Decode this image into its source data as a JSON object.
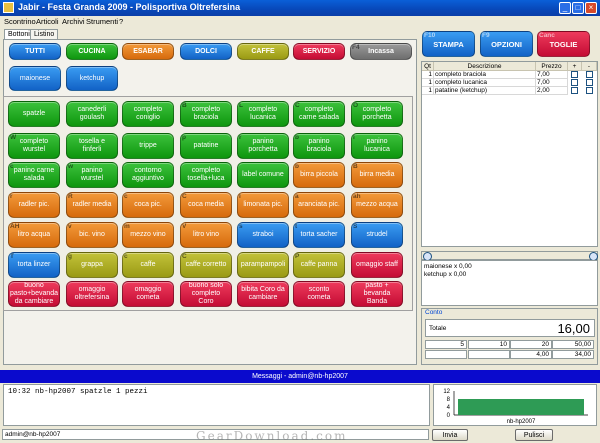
{
  "window": {
    "title": "Jabir - Festa Granda 2009 - Polisportiva Oltrefersina"
  },
  "menu": [
    "Scontrino",
    "Articoli",
    "Archivi",
    "Strumenti",
    "?"
  ],
  "tabs": [
    "Bottoni",
    "Listino"
  ],
  "categories": [
    {
      "label": "TUTTI",
      "color": "blue"
    },
    {
      "label": "CUCINA",
      "color": "green"
    },
    {
      "label": "ESABAR",
      "color": "orange"
    },
    {
      "label": "DOLCI",
      "color": "blue"
    },
    {
      "label": "CAFFE",
      "color": "olive"
    },
    {
      "label": "SERVIZIO",
      "color": "red"
    },
    {
      "label": "Incassa",
      "color": "grey",
      "key": "F4"
    }
  ],
  "notes_buttons": [
    "maionese",
    "ketchup"
  ],
  "product_rows": [
    [
      {
        "l": "spatzle",
        "c": "green"
      },
      {
        "l": "canederli goulash",
        "c": "green"
      },
      {
        "l": "completo coniglio",
        "c": "green"
      },
      {
        "l": "completo braciola",
        "c": "green",
        "k": "B"
      },
      {
        "l": "completo lucanica",
        "c": "green",
        "k": "L"
      },
      {
        "l": "completo carne salada",
        "c": "green",
        "k": "C"
      },
      {
        "l": "completo porchetta",
        "c": "green",
        "k": "O"
      }
    ],
    [
      {
        "l": "completo wurstel",
        "c": "green",
        "k": "W"
      },
      {
        "l": "tosella e finferli",
        "c": "green"
      },
      {
        "l": "trippe",
        "c": "green"
      },
      {
        "l": "patatine",
        "c": "green",
        "k": "p"
      },
      {
        "l": "panino porchetta",
        "c": "green",
        "k": "r"
      },
      {
        "l": "panino braciola",
        "c": "green",
        "k": "b"
      },
      {
        "l": "panino lucanica",
        "c": "green",
        "k": "l"
      }
    ],
    [
      {
        "l": "panino carne salada",
        "c": "green",
        "k": "c"
      },
      {
        "l": "panino wurstel",
        "c": "green",
        "k": "w"
      },
      {
        "l": "contorno aggiuntivo",
        "c": "green"
      },
      {
        "l": "completo tosella+luca",
        "c": "green"
      },
      {
        "l": "label comune",
        "c": "green"
      },
      {
        "l": "birra piccola",
        "c": "orange",
        "k": "b"
      },
      {
        "l": "birra media",
        "c": "orange",
        "k": "B"
      }
    ],
    [
      {
        "l": "radler pic.",
        "c": "orange",
        "k": "r"
      },
      {
        "l": "radler media",
        "c": "orange",
        "k": "R"
      },
      {
        "l": "coca pic.",
        "c": "orange",
        "k": "c"
      },
      {
        "l": "coca media",
        "c": "orange",
        "k": "C"
      },
      {
        "l": "limonata pic.",
        "c": "orange",
        "k": "l"
      },
      {
        "l": "aranciata pic.",
        "c": "orange",
        "k": "a"
      },
      {
        "l": "mezzo acqua",
        "c": "orange",
        "k": "ah"
      }
    ],
    [
      {
        "l": "litro acqua",
        "c": "orange",
        "k": "AH"
      },
      {
        "l": "bic. vino",
        "c": "orange",
        "k": "v"
      },
      {
        "l": "mezzo vino",
        "c": "orange",
        "k": "m"
      },
      {
        "l": "litro vino",
        "c": "orange",
        "k": "V"
      },
      {
        "l": "straboi",
        "c": "blue",
        "k": "s"
      },
      {
        "l": "torta sacher",
        "c": "blue",
        "k": "t"
      },
      {
        "l": "strudel",
        "c": "blue",
        "k": "S"
      }
    ],
    [
      {
        "l": "torta linzer",
        "c": "blue",
        "k": "T"
      },
      {
        "l": "grappa",
        "c": "olive",
        "k": "g"
      },
      {
        "l": "caffe",
        "c": "olive",
        "k": "c"
      },
      {
        "l": "caffe corretto",
        "c": "olive",
        "k": "C"
      },
      {
        "l": "parampampoli",
        "c": "olive"
      },
      {
        "l": "caffe panna",
        "c": "olive",
        "k": "P"
      },
      {
        "l": "omaggio staff",
        "c": "red"
      }
    ],
    [
      {
        "l": "buono pasto+bevanda da cambiare",
        "c": "red"
      },
      {
        "l": "omaggio oltrefersina",
        "c": "red"
      },
      {
        "l": "omaggio cometa",
        "c": "red"
      },
      {
        "l": "buono solo completo Coro",
        "c": "red"
      },
      {
        "l": "bibita Coro da cambiare",
        "c": "red"
      },
      {
        "l": "sconto cometa",
        "c": "red"
      },
      {
        "l": "pasto + bevanda Banda",
        "c": "red"
      }
    ]
  ],
  "top_buttons": [
    {
      "label": "STAMPA",
      "key": "F10",
      "color": "blue"
    },
    {
      "label": "OPZIONI",
      "key": "F9",
      "color": "blue"
    },
    {
      "label": "TOGLIE",
      "key": "Canc",
      "color": "red"
    }
  ],
  "order": {
    "headers": [
      "Qt",
      "Descrizione",
      "Prezzo",
      "+",
      "-"
    ],
    "rows": [
      {
        "qt": "1",
        "desc": "completo braciola",
        "price": "7,00"
      },
      {
        "qt": "1",
        "desc": "completo lucanica",
        "price": "7,00"
      },
      {
        "qt": "1",
        "desc": "patatine (ketchup)",
        "price": "2,00"
      }
    ]
  },
  "notes_list": [
    "maionese x 0,00",
    "ketchup x 0,00"
  ],
  "conto": {
    "label": "Conto",
    "totale_label": "Totale",
    "totale": "16,00",
    "denominations": [
      "5",
      "10",
      "20",
      "50,00"
    ],
    "change": [
      "",
      "",
      "4,00",
      "34,00"
    ]
  },
  "messages": {
    "title": "Messaggi - admin@nb-hp2007",
    "log": [
      "10:32 nb-hp2007 spatzle 1 pezzi"
    ]
  },
  "chart_data": {
    "type": "bar",
    "categories": [
      "nb-hp2007"
    ],
    "values": [
      8
    ],
    "ylim": [
      0,
      12
    ],
    "yticks": [
      "12",
      "8",
      "4",
      "0"
    ],
    "color": "#2e9b55"
  },
  "status": {
    "user": "admin@nb-hp2007",
    "send_label": "Invia",
    "clear_label": "Pulisci"
  },
  "watermark": "GearDownload.com"
}
